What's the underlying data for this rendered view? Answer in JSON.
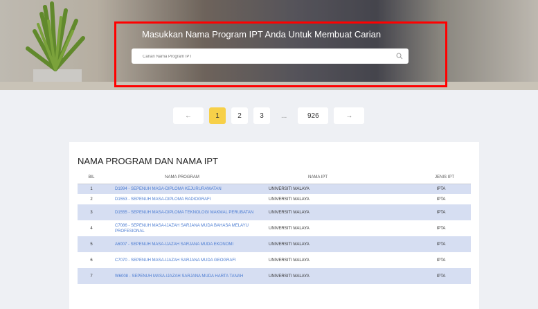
{
  "hero": {
    "title": "Masukkan Nama Program IPT Anda Untuk Membuat Carian",
    "search_placeholder": "Carian Nama Program IPT"
  },
  "pagination": {
    "prev": "←",
    "pages": [
      "1",
      "2",
      "3"
    ],
    "ellipsis": "...",
    "last": "926",
    "next": "→",
    "active": "1"
  },
  "table": {
    "title": "NAMA PROGRAM DAN NAMA IPT",
    "headers": {
      "no": "BIL",
      "program": "NAMA PROGRAM",
      "ipt": "NAMA IPT",
      "jenis": "JENIS IPT"
    },
    "rows": [
      {
        "no": "1",
        "program": "D1994 - SEPENUH MASA-DIPLOMA KEJURURAWATAN",
        "ipt": "UNIVERSITI MALAYA",
        "jenis": "IPTA"
      },
      {
        "no": "2",
        "program": "D1553 - SEPENUH MASA-DIPLOMA RADIOGRAFI",
        "ipt": "UNIVERSITI MALAYA",
        "jenis": "IPTA"
      },
      {
        "no": "3",
        "program": "D1555 - SEPENUH MASA-DIPLOMA TEKNOLOGI MAKMAL PERUBATAN",
        "ipt": "UNIVERSITI MALAYA",
        "jenis": "IPTA"
      },
      {
        "no": "4",
        "program": "C7086 - SEPENUH MASA-IJAZAH SARJANA MUDA BAHASA MELAYU PROFESIONAL",
        "ipt": "UNIVERSITI MALAYA",
        "jenis": "IPTA"
      },
      {
        "no": "5",
        "program": "A6007 - SEPENUH MASA-IJAZAH SARJANA MUDA EKONOMI",
        "ipt": "UNIVERSITI MALAYA",
        "jenis": "IPTA"
      },
      {
        "no": "6",
        "program": "C7070 - SEPENUH MASA-IJAZAH SARJANA MUDA GEOGRAFI",
        "ipt": "UNIVERSITI MALAYA",
        "jenis": "IPTA"
      },
      {
        "no": "7",
        "program": "W6008 - SEPENUH MASA-IJAZAH SARJANA MUDA HARTA TANAH",
        "ipt": "UNIVERSITI MALAYA",
        "jenis": "IPTA"
      }
    ]
  },
  "colors": {
    "accent_yellow": "#f7d048",
    "link_blue": "#4a7bd1",
    "row_shade": "#d6def2",
    "highlight_red": "#ff0000"
  }
}
